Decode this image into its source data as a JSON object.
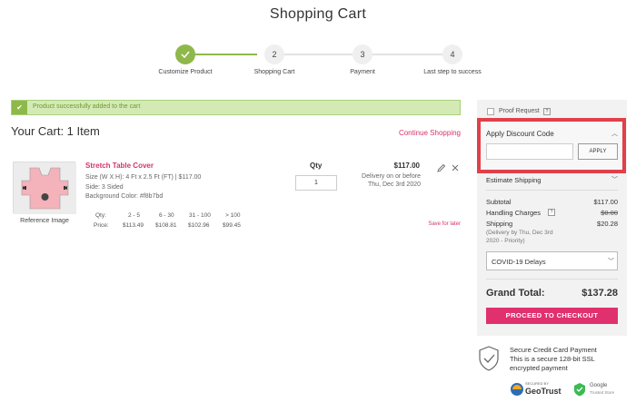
{
  "page": {
    "title": "Shopping Cart"
  },
  "steps": [
    {
      "number": "",
      "label": "Customize Product",
      "state": "done"
    },
    {
      "number": "2",
      "label": "Shopping Cart",
      "state": "current"
    },
    {
      "number": "3",
      "label": "Payment",
      "state": "todo"
    },
    {
      "number": "4",
      "label": "Last step to success",
      "state": "todo"
    }
  ],
  "alert": {
    "text": "Product successfully added to the cart",
    "icon": "check-icon"
  },
  "cart": {
    "title": "Your Cart: 1 Item",
    "continue_label": "Continue Shopping",
    "item": {
      "image_label": "Reference Image",
      "name": "Stretch Table Cover",
      "size": "Size (W X H): 4 Ft x 2.5 Ft (FT) | $117.00",
      "side": "Side: 3 Sided",
      "background": "Background Color: #f8b7bd",
      "qty_label": "Qty",
      "qty_value": "1",
      "price": "$117.00",
      "delivery_line1": "Delivery on or before",
      "delivery_line2": "Thu, Dec 3rd 2020",
      "save_later": "Save for later",
      "tiers": {
        "qty_label": "Qty:",
        "price_label": "Price:",
        "ranges": [
          "2 - 5",
          "6 - 30",
          "31 - 100",
          "> 100"
        ],
        "prices": [
          "$113.49",
          "$108.81",
          "$102.96",
          "$99.45"
        ]
      }
    }
  },
  "sidebar": {
    "proof_label": "Proof Request",
    "discount": {
      "title": "Apply Discount Code",
      "input_value": "",
      "apply_label": "APPLY"
    },
    "estimate_shipping": "Estimate Shipping",
    "summary": {
      "subtotal_label": "Subtotal",
      "subtotal_value": "$117.00",
      "handling_label": "Handling Charges",
      "handling_value": "$0.00",
      "shipping_label": "Shipping",
      "shipping_value": "$20.28",
      "shipping_note": "(Delivery by Thu, Dec 3rd 2020 - Priority)"
    },
    "covid_select": "COVID-19 Delays",
    "grand_total_label": "Grand Total:",
    "grand_total_value": "$137.28",
    "checkout_label": "PROCEED TO CHECKOUT",
    "secure": {
      "title": "Secure Credit Card Payment",
      "text": "This is a secure 128-bit SSL encrypted payment",
      "geotrust_small": "SECURED BY",
      "geotrust_name": "GeoTrust",
      "google_name": "Google",
      "google_sub": "Trusted Store"
    }
  },
  "colors": {
    "accent": "#d6336c",
    "success": "#8fb84a",
    "highlight": "#e0404a"
  }
}
